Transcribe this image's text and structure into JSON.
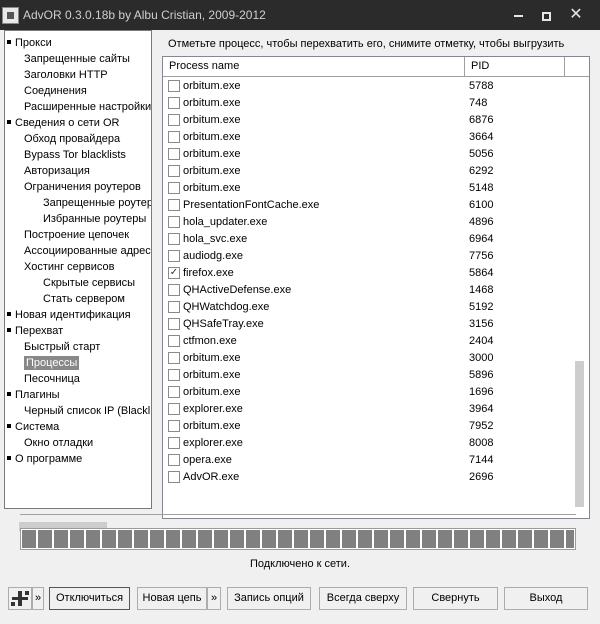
{
  "window": {
    "title": "AdvOR  0.3.0.18b by Albu Cristian, 2009-2012",
    "minimize_glyph": "",
    "maximize_glyph": "",
    "close_glyph": "✕"
  },
  "tree": {
    "items": [
      {
        "label": "Прокси",
        "level": 0
      },
      {
        "label": "Запрещенные сайты",
        "level": 1
      },
      {
        "label": "Заголовки HTTP",
        "level": 1
      },
      {
        "label": "Соединения",
        "level": 1
      },
      {
        "label": "Расширенные настройки",
        "level": 1
      },
      {
        "label": "Сведения о сети OR",
        "level": 0
      },
      {
        "label": "Обход провайдера",
        "level": 1
      },
      {
        "label": "Bypass Tor blacklists",
        "level": 1
      },
      {
        "label": "Авторизация",
        "level": 1
      },
      {
        "label": "Ограничения роутеров",
        "level": 1
      },
      {
        "label": "Запрещенные роутеры",
        "level": 2
      },
      {
        "label": "Избранные роутеры",
        "level": 2
      },
      {
        "label": "Построение цепочек",
        "level": 1
      },
      {
        "label": "Ассоциированные адреса",
        "level": 1
      },
      {
        "label": "Хостинг сервисов",
        "level": 1
      },
      {
        "label": "Скрытые сервисы",
        "level": 2
      },
      {
        "label": "Стать сервером",
        "level": 2
      },
      {
        "label": "Новая идентификация",
        "level": 0
      },
      {
        "label": "Перехват",
        "level": 0
      },
      {
        "label": "Быстрый старт",
        "level": 1
      },
      {
        "label": "Процессы",
        "level": 1,
        "selected": true
      },
      {
        "label": "Песочница",
        "level": 1
      },
      {
        "label": "Плагины",
        "level": 0
      },
      {
        "label": "Черный список IP (Blacklist)",
        "level": 1
      },
      {
        "label": "Система",
        "level": 0
      },
      {
        "label": "Окно отладки",
        "level": 1
      },
      {
        "label": "О программе",
        "level": 0
      }
    ]
  },
  "main": {
    "instruction": "Отметьте процесс, чтобы перехватить его, снимите отметку, чтобы выгрузить",
    "columns": {
      "name": "Process name",
      "pid": "PID"
    },
    "processes": [
      {
        "name": "orbitum.exe",
        "pid": "5788",
        "checked": false
      },
      {
        "name": "orbitum.exe",
        "pid": "748",
        "checked": false
      },
      {
        "name": "orbitum.exe",
        "pid": "6876",
        "checked": false
      },
      {
        "name": "orbitum.exe",
        "pid": "3664",
        "checked": false
      },
      {
        "name": "orbitum.exe",
        "pid": "5056",
        "checked": false
      },
      {
        "name": "orbitum.exe",
        "pid": "6292",
        "checked": false
      },
      {
        "name": "orbitum.exe",
        "pid": "5148",
        "checked": false
      },
      {
        "name": "PresentationFontCache.exe",
        "pid": "6100",
        "checked": false
      },
      {
        "name": "hola_updater.exe",
        "pid": "4896",
        "checked": false
      },
      {
        "name": "hola_svc.exe",
        "pid": "6964",
        "checked": false
      },
      {
        "name": "audiodg.exe",
        "pid": "7756",
        "checked": false
      },
      {
        "name": "firefox.exe",
        "pid": "5864",
        "checked": true
      },
      {
        "name": "QHActiveDefense.exe",
        "pid": "1468",
        "checked": false
      },
      {
        "name": "QHWatchdog.exe",
        "pid": "5192",
        "checked": false
      },
      {
        "name": "QHSafeTray.exe",
        "pid": "3156",
        "checked": false
      },
      {
        "name": "ctfmon.exe",
        "pid": "2404",
        "checked": false
      },
      {
        "name": "orbitum.exe",
        "pid": "3000",
        "checked": false
      },
      {
        "name": "orbitum.exe",
        "pid": "5896",
        "checked": false
      },
      {
        "name": "orbitum.exe",
        "pid": "1696",
        "checked": false
      },
      {
        "name": "explorer.exe",
        "pid": "3964",
        "checked": false
      },
      {
        "name": "orbitum.exe",
        "pid": "7952",
        "checked": false
      },
      {
        "name": "explorer.exe",
        "pid": "8008",
        "checked": false
      },
      {
        "name": "opera.exe",
        "pid": "7144",
        "checked": false
      },
      {
        "name": "AdvOR.exe",
        "pid": "2696",
        "checked": false
      }
    ]
  },
  "progress": {
    "value": 1.0
  },
  "status": "Подключено к сети.",
  "toolbar": {
    "tool_arrow": "»",
    "disconnect": "Отключиться",
    "new_circuit": "Новая цепь",
    "new_circuit_arrow": "»",
    "save_options": "Запись опций",
    "always_on_top": "Всегда сверху",
    "minimize": "Свернуть",
    "exit": "Выход"
  },
  "colors": {
    "titlebar": "#2b2b2b",
    "selection": "#888888",
    "progress": "#808080"
  }
}
